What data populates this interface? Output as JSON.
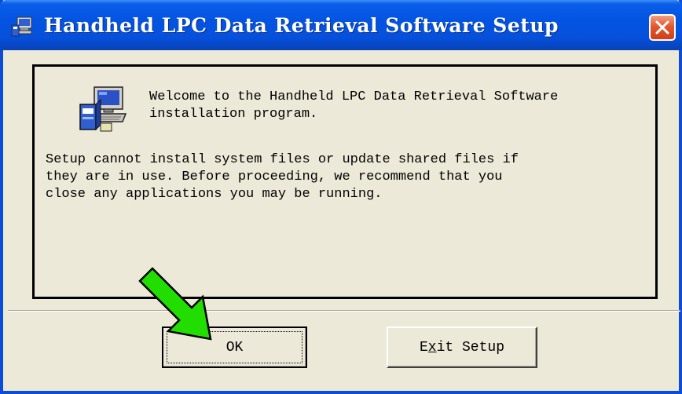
{
  "window": {
    "title": "Handheld LPC Data Retrieval Software Setup",
    "accent_color": "#0a4ddb",
    "close_button_color": "#e2582f"
  },
  "content": {
    "welcome_text": "Welcome to the Handheld LPC Data Retrieval Software\ninstallation program.",
    "info_text": "Setup cannot install system files or update shared files if\nthey are in use. Before proceeding, we recommend that you\nclose any applications you may be running.",
    "icon": "setup-computer-icon"
  },
  "buttons": {
    "ok_label": "OK",
    "exit_label_pre": "E",
    "exit_label_mnemonic": "x",
    "exit_label_post": "it Setup"
  },
  "annotation": {
    "arrow_color": "#22dd00",
    "arrow_icon": "green-arrow-icon"
  }
}
